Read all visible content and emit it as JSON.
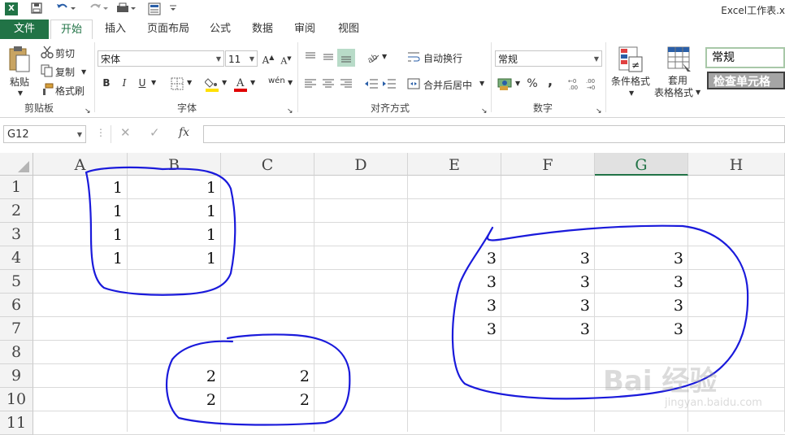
{
  "titlebar": {
    "app_icon": "excel-icon",
    "title": "Excel工作表.x"
  },
  "tabs": {
    "file": "文件",
    "items": [
      "开始",
      "插入",
      "页面布局",
      "公式",
      "数据",
      "审阅",
      "视图"
    ],
    "active": "开始"
  },
  "ribbon": {
    "clipboard": {
      "paste": "粘贴",
      "cut": "剪切",
      "copy": "复制",
      "format_painter": "格式刷",
      "label": "剪贴板"
    },
    "font": {
      "font_name": "宋体",
      "font_size": "11",
      "label": "字体",
      "bold": "B",
      "italic": "I",
      "underline": "U",
      "phonetic": "wén"
    },
    "alignment": {
      "wrap_text": "自动换行",
      "merge_center": "合并后居中",
      "label": "对齐方式"
    },
    "number": {
      "format": "常规",
      "percent": "%",
      "comma": ",",
      "label": "数字"
    },
    "styles": {
      "conditional": "条件格式",
      "table_format_line1": "套用",
      "table_format_line2": "表格格式",
      "style_normal": "常规",
      "style_check": "检查单元格"
    }
  },
  "formula_bar": {
    "name_box": "G12",
    "fx": "fx",
    "value": ""
  },
  "grid": {
    "columns": [
      "A",
      "B",
      "C",
      "D",
      "E",
      "F",
      "G",
      "H"
    ],
    "selected_column": "G",
    "rows": [
      "1",
      "2",
      "3",
      "4",
      "5",
      "6",
      "7",
      "8",
      "9",
      "10",
      "11"
    ],
    "cells": {
      "A1": "1",
      "B1": "1",
      "A2": "1",
      "B2": "1",
      "A3": "1",
      "B3": "1",
      "A4": "1",
      "B4": "1",
      "B9": "2",
      "C9": "2",
      "B10": "2",
      "C10": "2",
      "E4": "3",
      "F4": "3",
      "G4": "3",
      "E5": "3",
      "F5": "3",
      "G5": "3",
      "E6": "3",
      "F6": "3",
      "G6": "3",
      "E7": "3",
      "F7": "3",
      "G7": "3"
    }
  },
  "watermark": {
    "brand": "Bai 经验",
    "url": "jingyan.baidu.com"
  },
  "colors": {
    "excel_green": "#217346",
    "annotation_blue": "#1a1adb"
  }
}
